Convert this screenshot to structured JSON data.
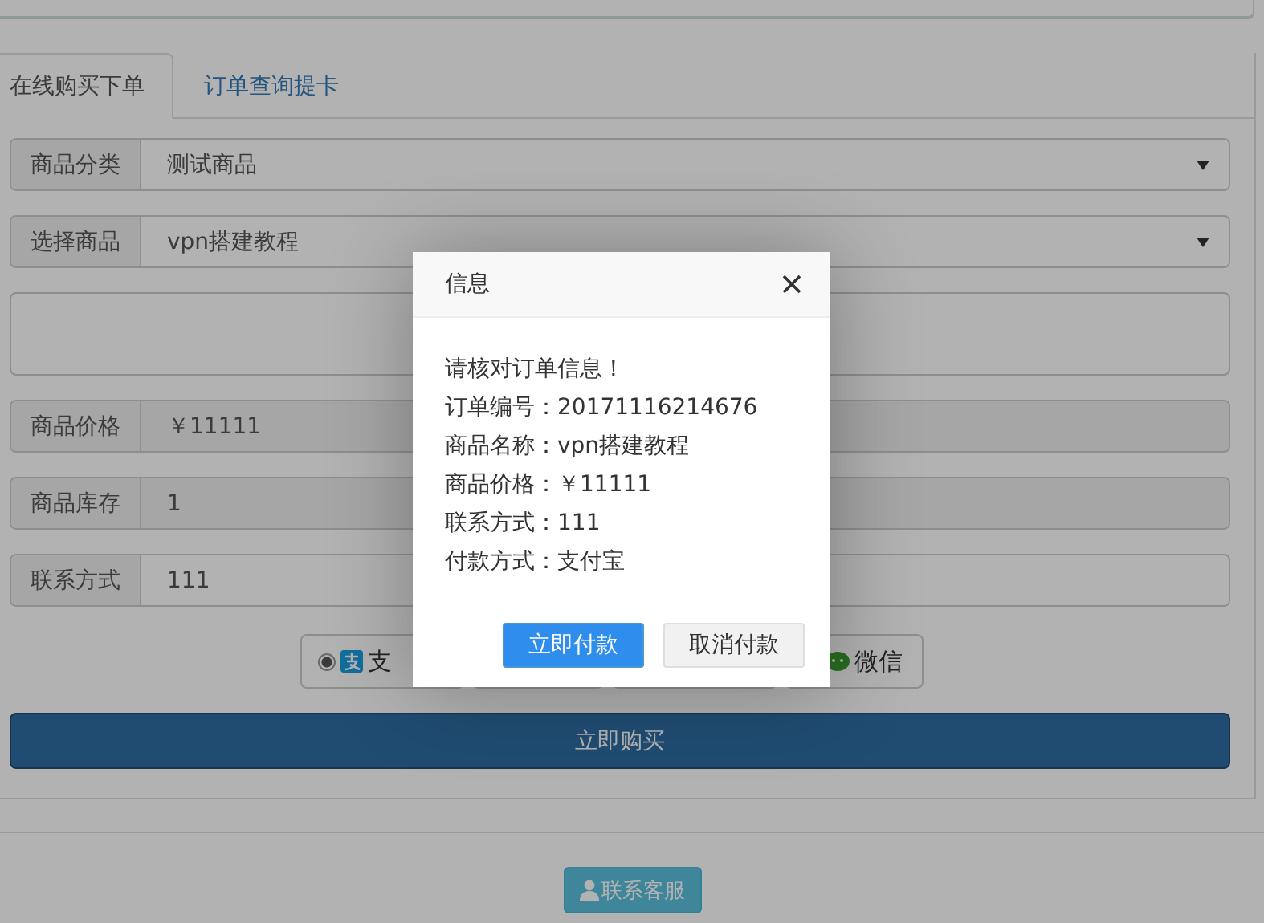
{
  "tabs": [
    {
      "label": "在线购买下单",
      "selected": true
    },
    {
      "label": "订单查询提卡",
      "selected": false
    }
  ],
  "fields": [
    {
      "kind": "select",
      "label": "商品分类",
      "value": "测试商品"
    },
    {
      "kind": "select",
      "label": "选择商品",
      "value": "vpn搭建教程"
    },
    {
      "kind": "note"
    },
    {
      "kind": "readonly",
      "label": "商品价格",
      "value": "￥11111"
    },
    {
      "kind": "readonly",
      "label": "商品库存",
      "value": "1"
    },
    {
      "kind": "input",
      "label": "联系方式",
      "value": "111"
    }
  ],
  "payment_options": [
    {
      "kind": "alipay",
      "label": "支",
      "selected": true
    },
    {
      "kind": "blank"
    },
    {
      "kind": "blank"
    },
    {
      "kind": "wechat",
      "label": "微信"
    }
  ],
  "buy_button": "立即购买",
  "support_button": "联系客服",
  "dialog": {
    "title": "信息",
    "lines": [
      "请核对订单信息！",
      "订单编号：20171116214676",
      "商品名称：vpn搭建教程",
      "商品价格：￥11111",
      "联系方式：111",
      "付款方式：支付宝"
    ],
    "buttons": [
      {
        "kind": "primary",
        "label": "立即付款"
      },
      {
        "kind": "default",
        "label": "取消付款"
      }
    ]
  }
}
